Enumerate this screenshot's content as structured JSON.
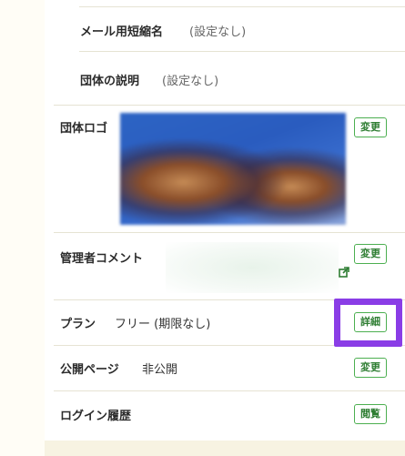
{
  "rows": {
    "email_short_name": {
      "label": "メール用短縮名",
      "value": "(設定なし)"
    },
    "group_description": {
      "label": "団体の説明",
      "value": "(設定なし)"
    },
    "group_logo": {
      "label": "団体ロゴ",
      "button": "変更"
    },
    "admin_comment": {
      "label": "管理者コメント",
      "button": "変更"
    },
    "plan": {
      "label": "プラン",
      "value": "フリー (期限なし)",
      "button": "詳細"
    },
    "public_page": {
      "label": "公開ページ",
      "value": "非公開",
      "button": "変更"
    },
    "login_history": {
      "label": "ログイン履歴",
      "button": "閲覧"
    }
  },
  "colors": {
    "accent_green": "#4caf50",
    "highlight_purple": "#8a3de6",
    "page_bg": "#f7f3e2"
  },
  "icons": {
    "external_link": "external-link-icon"
  }
}
